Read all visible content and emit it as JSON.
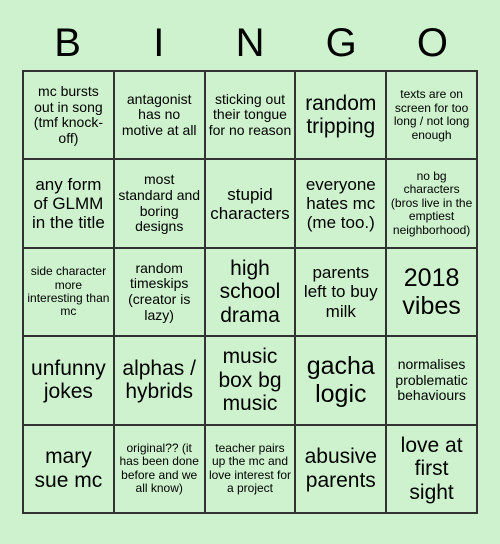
{
  "card": {
    "background_color": "#cdf2cd",
    "border_color": "#333333",
    "text_color": "#000000",
    "header": {
      "letters": [
        "B",
        "I",
        "N",
        "G",
        "O"
      ]
    },
    "grid": {
      "rows": 5,
      "columns": 5,
      "cells": [
        {
          "text": "mc bursts out in song (tmf knock-off)",
          "size": "fs-sm"
        },
        {
          "text": "antagonist has no motive at all",
          "size": "fs-sm"
        },
        {
          "text": "sticking out their tongue for no reason",
          "size": "fs-sm"
        },
        {
          "text": "random tripping",
          "size": "fs-lg"
        },
        {
          "text": "texts are on screen for too long / not long enough",
          "size": "fs-xs"
        },
        {
          "text": "any form of GLMM in the title",
          "size": "fs-md"
        },
        {
          "text": "most standard and boring designs",
          "size": "fs-sm"
        },
        {
          "text": "stupid characters",
          "size": "fs-md"
        },
        {
          "text": "everyone hates mc (me too.)",
          "size": "fs-md"
        },
        {
          "text": "no bg characters (bros live in the emptiest neighborhood)",
          "size": "fs-xs"
        },
        {
          "text": "side character more interesting than mc",
          "size": "fs-xs"
        },
        {
          "text": "random timeskips (creator is lazy)",
          "size": "fs-sm"
        },
        {
          "text": "high school drama",
          "size": "fs-lg"
        },
        {
          "text": "parents left to buy milk",
          "size": "fs-md"
        },
        {
          "text": "2018 vibes",
          "size": "fs-xl"
        },
        {
          "text": "unfunny jokes",
          "size": "fs-lg"
        },
        {
          "text": "alphas / hybrids",
          "size": "fs-lg"
        },
        {
          "text": "music box bg music",
          "size": "fs-lg"
        },
        {
          "text": "gacha logic",
          "size": "fs-xl"
        },
        {
          "text": "normalises problematic behaviours",
          "size": "fs-sm"
        },
        {
          "text": "mary sue mc",
          "size": "fs-lg"
        },
        {
          "text": "original?? (it has been done before and we all know)",
          "size": "fs-xs"
        },
        {
          "text": "teacher pairs up the mc and love interest for a project",
          "size": "fs-xs"
        },
        {
          "text": "abusive parents",
          "size": "fs-lg"
        },
        {
          "text": "love at first sight",
          "size": "fs-lg"
        }
      ]
    }
  }
}
